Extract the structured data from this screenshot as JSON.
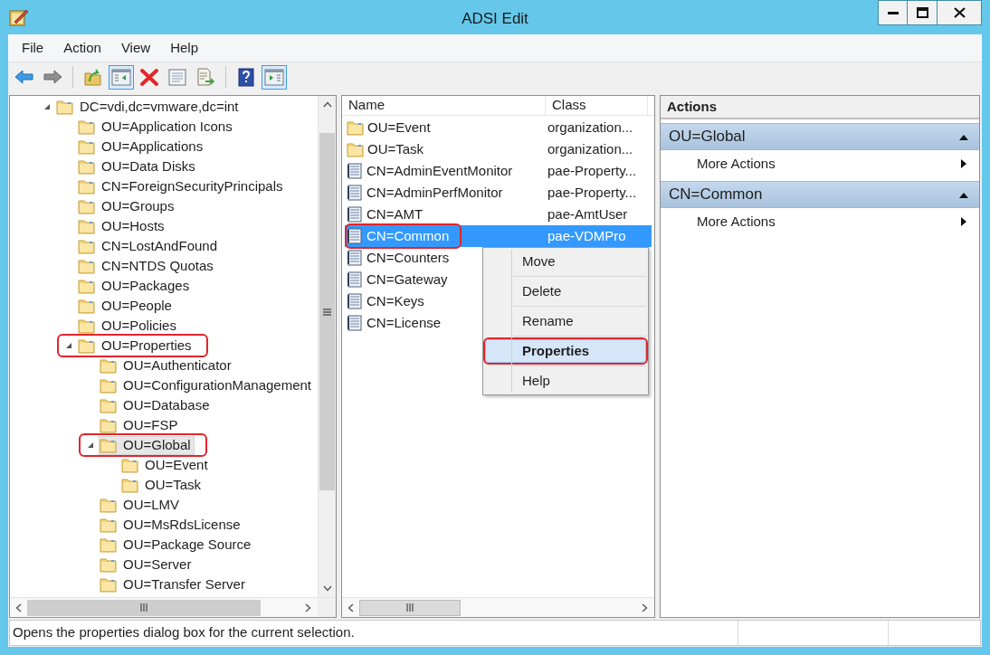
{
  "window": {
    "title": "ADSI Edit"
  },
  "menu": [
    "File",
    "Action",
    "View",
    "Help"
  ],
  "toolbar": [
    {
      "kind": "back",
      "pressed": false
    },
    {
      "kind": "forward",
      "pressed": false
    },
    {
      "kind": "separator"
    },
    {
      "kind": "up",
      "pressed": false
    },
    {
      "kind": "tree",
      "pressed": true
    },
    {
      "kind": "delete",
      "pressed": false
    },
    {
      "kind": "properties",
      "pressed": false
    },
    {
      "kind": "export",
      "pressed": false
    },
    {
      "kind": "separator"
    },
    {
      "kind": "help",
      "pressed": false
    },
    {
      "kind": "actionpane",
      "pressed": true
    }
  ],
  "tree": {
    "items": [
      {
        "label": "DC=vdi,dc=vmware,dc=int",
        "expanded": true,
        "selected": false,
        "annotated": false,
        "children": [
          {
            "label": "OU=Application Icons",
            "selected": false,
            "annotated": false
          },
          {
            "label": "OU=Applications",
            "selected": false,
            "annotated": false
          },
          {
            "label": "OU=Data Disks",
            "selected": false,
            "annotated": false
          },
          {
            "label": "CN=ForeignSecurityPrincipals",
            "selected": false,
            "annotated": false
          },
          {
            "label": "OU=Groups",
            "selected": false,
            "annotated": false
          },
          {
            "label": "OU=Hosts",
            "selected": false,
            "annotated": false
          },
          {
            "label": "CN=LostAndFound",
            "selected": false,
            "annotated": false
          },
          {
            "label": "CN=NTDS Quotas",
            "selected": false,
            "annotated": false
          },
          {
            "label": "OU=Packages",
            "selected": false,
            "annotated": false
          },
          {
            "label": "OU=People",
            "selected": false,
            "annotated": false
          },
          {
            "label": "OU=Policies",
            "selected": false,
            "annotated": false
          },
          {
            "label": "OU=Properties",
            "expanded": true,
            "selected": false,
            "annotated": true,
            "children": [
              {
                "label": "OU=Authenticator",
                "selected": false,
                "annotated": false
              },
              {
                "label": "OU=ConfigurationManagement",
                "selected": false,
                "annotated": false
              },
              {
                "label": "OU=Database",
                "selected": false,
                "annotated": false
              },
              {
                "label": "OU=FSP",
                "selected": false,
                "annotated": false
              },
              {
                "label": "OU=Global",
                "expanded": true,
                "selected": true,
                "annotated": true,
                "children": [
                  {
                    "label": "OU=Event",
                    "selected": false,
                    "annotated": false
                  },
                  {
                    "label": "OU=Task",
                    "selected": false,
                    "annotated": false
                  }
                ]
              },
              {
                "label": "OU=LMV",
                "selected": false,
                "annotated": false
              },
              {
                "label": "OU=MsRdsLicense",
                "selected": false,
                "annotated": false
              },
              {
                "label": "OU=Package Source",
                "selected": false,
                "annotated": false
              },
              {
                "label": "OU=Server",
                "selected": false,
                "annotated": false
              },
              {
                "label": "OU=Transfer Server",
                "selected": false,
                "annotated": false
              }
            ]
          }
        ]
      }
    ]
  },
  "list": {
    "columns": [
      "Name",
      "Class"
    ],
    "rows": [
      {
        "kind": "folder",
        "name": "OU=Event",
        "class": "organization...",
        "selected": false,
        "annotated": false
      },
      {
        "kind": "folder",
        "name": "OU=Task",
        "class": "organization...",
        "selected": false,
        "annotated": false
      },
      {
        "kind": "object",
        "name": "CN=AdminEventMonitor",
        "class": "pae-Property...",
        "selected": false,
        "annotated": false
      },
      {
        "kind": "object",
        "name": "CN=AdminPerfMonitor",
        "class": "pae-Property...",
        "selected": false,
        "annotated": false
      },
      {
        "kind": "object",
        "name": "CN=AMT",
        "class": "pae-AmtUser",
        "selected": false,
        "annotated": false
      },
      {
        "kind": "object",
        "name": "CN=Common",
        "class": "pae-VDMPro",
        "selected": true,
        "annotated": true
      },
      {
        "kind": "object",
        "name": "CN=Counters",
        "selected": false,
        "annotated": false
      },
      {
        "kind": "object",
        "name": "CN=Gateway",
        "selected": false,
        "annotated": false
      },
      {
        "kind": "object",
        "name": "CN=Keys",
        "selected": false,
        "annotated": false
      },
      {
        "kind": "object",
        "name": "CN=License",
        "selected": false,
        "annotated": false
      }
    ]
  },
  "context_menu": {
    "items": [
      {
        "kind": "item",
        "label": "Move",
        "selected": false,
        "default": false,
        "annotated": false
      },
      {
        "kind": "separator"
      },
      {
        "kind": "item",
        "label": "Delete",
        "selected": false,
        "default": false,
        "annotated": false
      },
      {
        "kind": "separator"
      },
      {
        "kind": "item",
        "label": "Rename",
        "selected": false,
        "default": false,
        "annotated": false
      },
      {
        "kind": "separator"
      },
      {
        "kind": "item",
        "label": "Properties",
        "selected": true,
        "default": true,
        "annotated": true
      },
      {
        "kind": "separator"
      },
      {
        "kind": "item",
        "label": "Help",
        "selected": false,
        "default": false,
        "annotated": false
      }
    ]
  },
  "actions": {
    "title": "Actions",
    "sections": [
      {
        "title": "OU=Global",
        "expanded": true,
        "items": [
          "More Actions"
        ]
      },
      {
        "title": "CN=Common",
        "expanded": true,
        "items": [
          "More Actions"
        ]
      }
    ]
  },
  "status_bar": {
    "text": "Opens the properties dialog box for the current selection."
  }
}
